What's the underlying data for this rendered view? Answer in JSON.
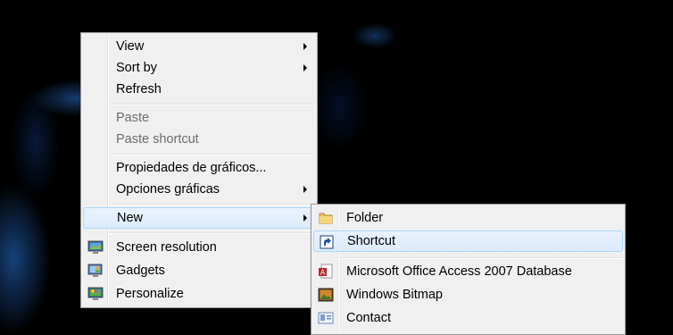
{
  "context_menu": {
    "items": [
      {
        "label": "View",
        "submenu": true
      },
      {
        "label": "Sort by",
        "submenu": true
      },
      {
        "label": "Refresh"
      },
      {
        "label": "Paste",
        "disabled": true
      },
      {
        "label": "Paste shortcut",
        "disabled": true
      },
      {
        "label": "Propiedades de gráficos..."
      },
      {
        "label": "Opciones gráficas",
        "submenu": true
      },
      {
        "label": "New",
        "submenu": true,
        "highlighted": true
      },
      {
        "label": "Screen resolution",
        "icon": "screen-resolution-icon"
      },
      {
        "label": "Gadgets",
        "icon": "gadgets-icon"
      },
      {
        "label": "Personalize",
        "icon": "personalize-icon"
      }
    ]
  },
  "new_submenu": {
    "items": [
      {
        "label": "Folder",
        "icon": "folder-icon"
      },
      {
        "label": "Shortcut",
        "icon": "shortcut-icon",
        "highlighted": true
      },
      {
        "label": "Microsoft Office Access 2007 Database",
        "icon": "access-database-icon"
      },
      {
        "label": "Windows Bitmap",
        "icon": "bitmap-icon"
      },
      {
        "label": "Contact",
        "icon": "contact-icon"
      }
    ]
  },
  "colors": {
    "menu_background": "#f0f0f0",
    "menu_border": "#979797",
    "highlight_border": "#a8d8fb",
    "disabled_text": "#6d6d6d",
    "desktop_background": "#000000"
  }
}
